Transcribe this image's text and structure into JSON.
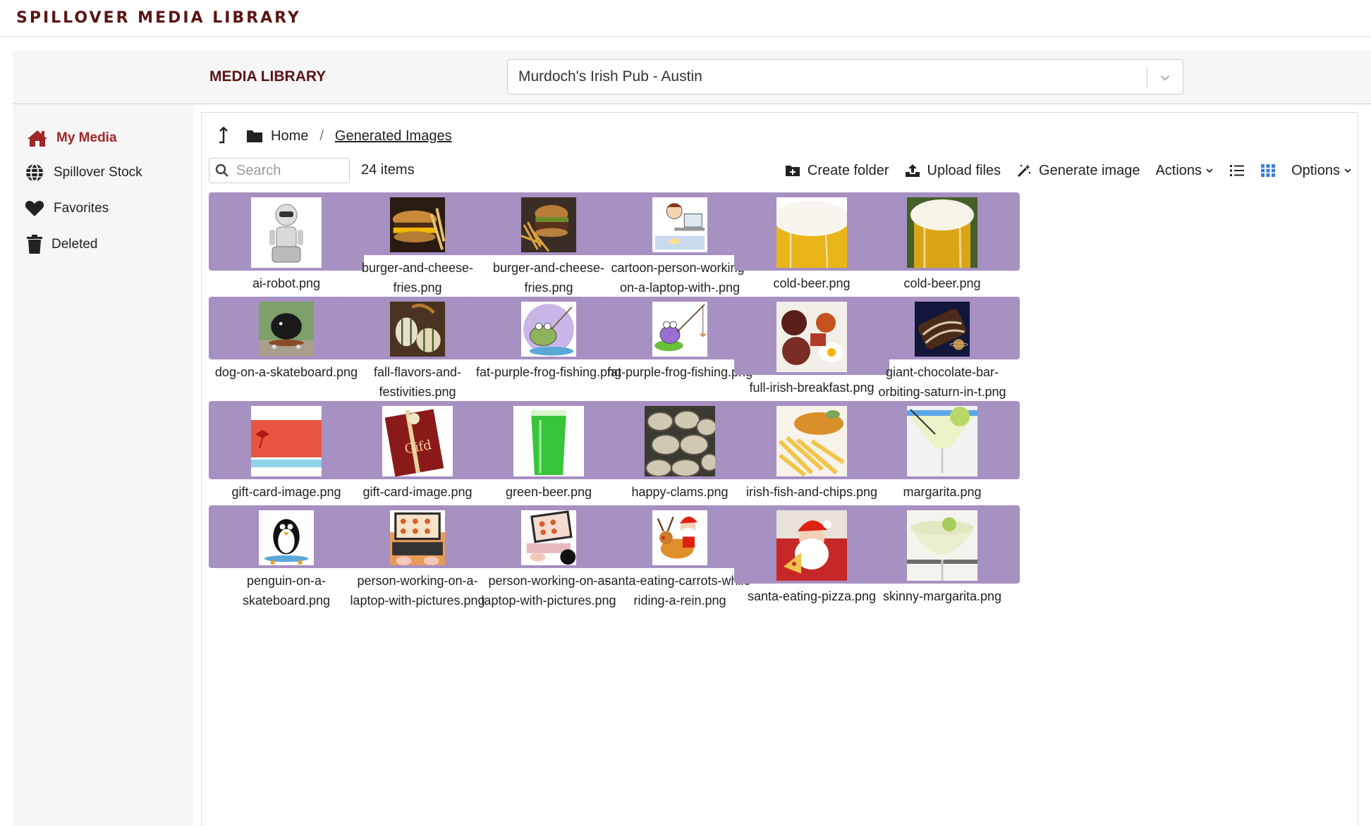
{
  "app": {
    "title": "SPILLOVER MEDIA LIBRARY"
  },
  "library": {
    "title": "MEDIA LIBRARY",
    "location": "Murdoch's Irish Pub - Austin"
  },
  "sidebar": {
    "items": [
      {
        "label": "My Media",
        "icon": "home-icon",
        "active": true
      },
      {
        "label": "Spillover Stock",
        "icon": "globe-icon",
        "active": false
      },
      {
        "label": "Favorites",
        "icon": "heart-icon",
        "active": false
      },
      {
        "label": "Deleted",
        "icon": "trash-icon",
        "active": false
      }
    ]
  },
  "breadcrumb": {
    "home": "Home",
    "separator": "/",
    "current": "Generated Images"
  },
  "toolbar": {
    "search_placeholder": "Search",
    "count": "24 items",
    "create_folder": "Create folder",
    "upload": "Upload files",
    "generate": "Generate image",
    "actions": "Actions",
    "options": "Options"
  },
  "colors": {
    "accent": "#a0262a",
    "title": "#5a1414",
    "tile": "#a790c2",
    "grid_view_active": "#3b7dd8"
  },
  "files": [
    {
      "name": "ai-robot.png",
      "image": "robot"
    },
    {
      "name": "burger-and-cheese-fries.png",
      "image": "burger-dark"
    },
    {
      "name": "burger-and-cheese-fries.png",
      "image": "burger-fries"
    },
    {
      "name": "cartoon-person-working-on-a-laptop-with-.png",
      "image": "cartoon-laptop"
    },
    {
      "name": "cold-beer.png",
      "image": "beer"
    },
    {
      "name": "cold-beer.png",
      "image": "beer-green"
    },
    {
      "name": "dog-on-a-skateboard.png",
      "image": "dog"
    },
    {
      "name": "fall-flavors-and-festivities.png",
      "image": "gourds"
    },
    {
      "name": "fat-purple-frog-fishing.png",
      "image": "frog-circle"
    },
    {
      "name": "fat-purple-frog-fishing.png",
      "image": "frog-pad"
    },
    {
      "name": "full-irish-breakfast.png",
      "image": "breakfast"
    },
    {
      "name": "giant-chocolate-bar-orbiting-saturn-in-t.png",
      "image": "chocolate"
    },
    {
      "name": "gift-card-image.png",
      "image": "gift-red"
    },
    {
      "name": "gift-card-image.png",
      "image": "gift-book"
    },
    {
      "name": "green-beer.png",
      "image": "green-beer"
    },
    {
      "name": "happy-clams.png",
      "image": "clams"
    },
    {
      "name": "irish-fish-and-chips.png",
      "image": "fish-chips"
    },
    {
      "name": "margarita.png",
      "image": "margarita"
    },
    {
      "name": "penguin-on-a-skateboard.png",
      "image": "penguin"
    },
    {
      "name": "person-working-on-a-laptop-with-pictures.png",
      "image": "laptop-food"
    },
    {
      "name": "person-working-on-a-laptop-with-pictures.png",
      "image": "laptop-food-2"
    },
    {
      "name": "santa-eating-carrots-while-riding-a-rein.png",
      "image": "santa-reindeer"
    },
    {
      "name": "santa-eating-pizza.png",
      "image": "santa-pizza"
    },
    {
      "name": "skinny-margarita.png",
      "image": "skinny-margarita"
    }
  ]
}
